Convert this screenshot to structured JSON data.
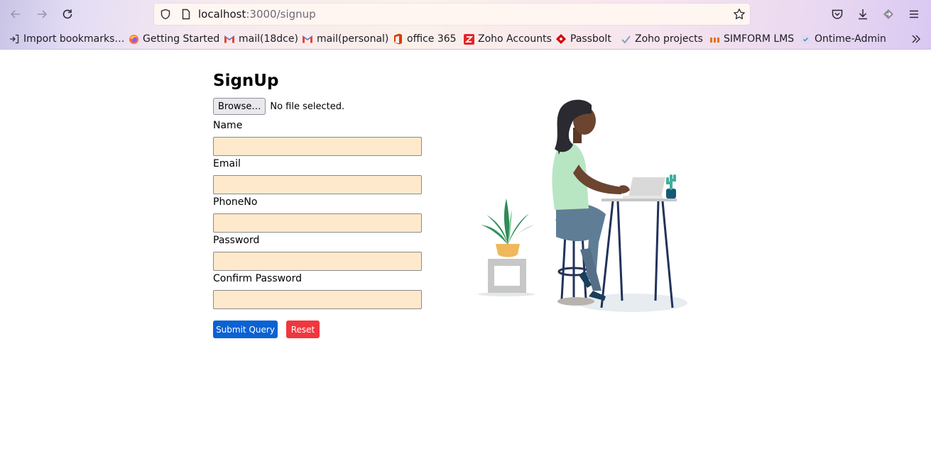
{
  "browser": {
    "url_host": "localhost",
    "url_rest": ":3000/signup",
    "bookmarks": [
      {
        "label": "Import bookmarks…",
        "icon": "import-icon"
      },
      {
        "label": "Getting Started",
        "icon": "firefox-icon"
      },
      {
        "label": "mail(18dce)",
        "icon": "gmail-icon"
      },
      {
        "label": "mail(personal)",
        "icon": "gmail-icon"
      },
      {
        "label": "office 365",
        "icon": "office-icon"
      },
      {
        "label": "Zoho Accounts",
        "icon": "zoho-icon"
      },
      {
        "label": "Passbolt",
        "icon": "passbolt-icon"
      },
      {
        "label": "Zoho projects",
        "icon": "zoho-projects-icon"
      },
      {
        "label": "SIMFORM LMS",
        "icon": "simform-icon"
      },
      {
        "label": "Ontime-Admin",
        "icon": "ontime-icon"
      }
    ]
  },
  "page": {
    "title": "SignUp",
    "file": {
      "button_label": "Browse…",
      "status": "No file selected."
    },
    "fields": [
      {
        "label": "Name",
        "value": ""
      },
      {
        "label": "Email",
        "value": ""
      },
      {
        "label": "PhoneNo",
        "value": ""
      },
      {
        "label": "Password",
        "value": ""
      },
      {
        "label": "Confirm Password",
        "value": ""
      }
    ],
    "submit_label": "Submit Query",
    "reset_label": "Reset"
  },
  "colors": {
    "field_bg": "#ffe9cc",
    "submit_bg": "#0b62d3",
    "reset_bg": "#f0373f"
  }
}
